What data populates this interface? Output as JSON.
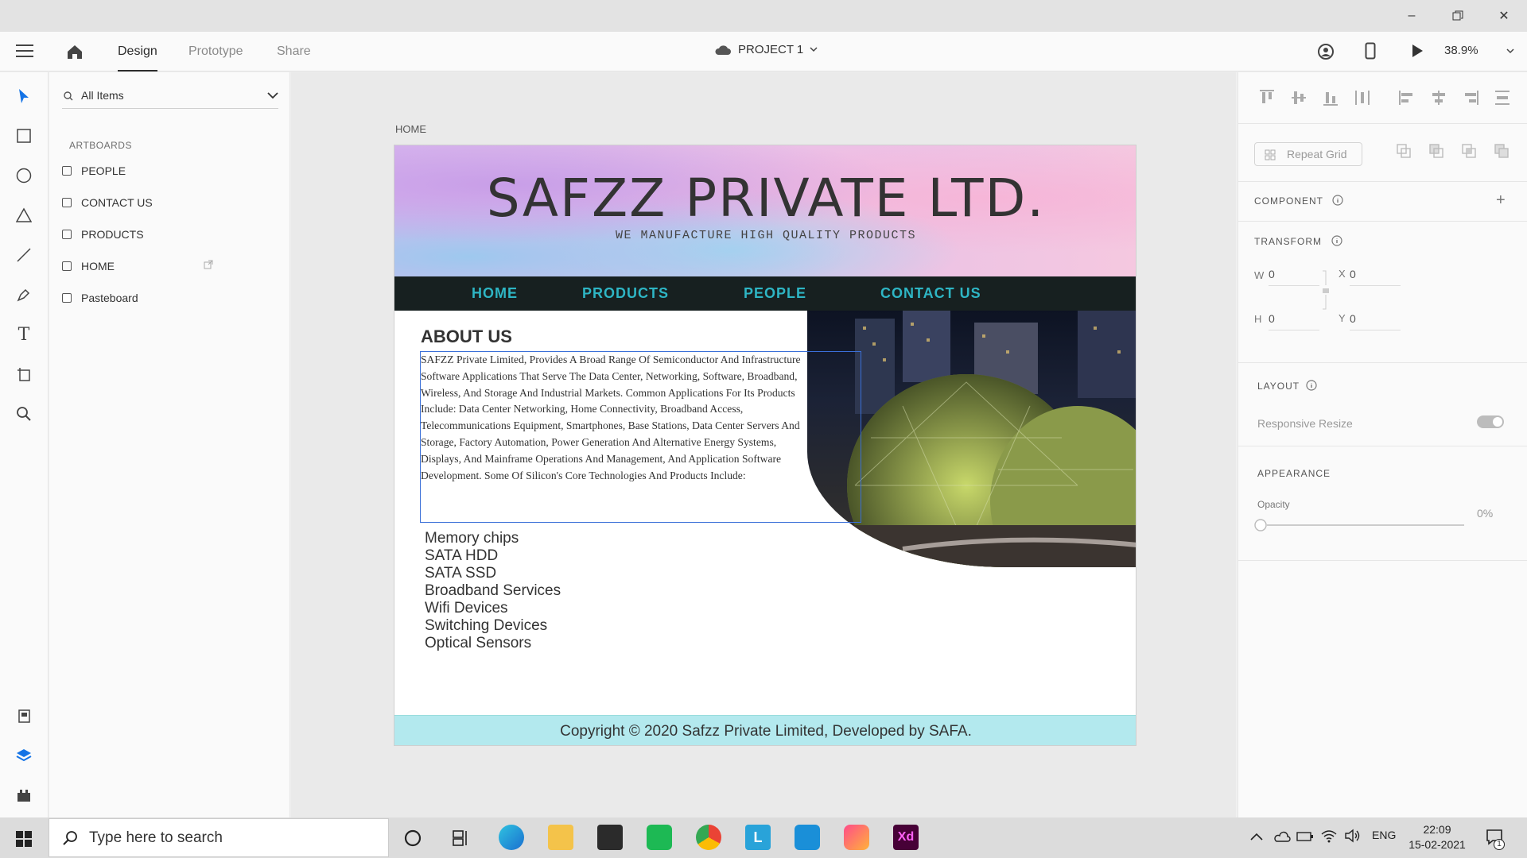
{
  "app": {
    "tabs": [
      "Design",
      "Prototype",
      "Share"
    ],
    "project_name": "PROJECT 1",
    "zoom": "38.9%"
  },
  "layers": {
    "search_placeholder": "All Items",
    "section_label": "ARTBOARDS",
    "items": [
      "PEOPLE",
      "CONTACT US",
      "PRODUCTS",
      "HOME",
      "Pasteboard"
    ]
  },
  "canvas": {
    "artboard_label": "HOME",
    "site": {
      "title": "SAFZZ PRIVATE LTD.",
      "subtitle": "WE MANUFACTURE HIGH QUALITY PRODUCTS",
      "nav": [
        "HOME",
        "PRODUCTS",
        "PEOPLE",
        "CONTACT US"
      ],
      "about_heading": "ABOUT US",
      "about_text": "SAFZZ Private Limited, Provides A Broad Range Of Semiconductor And Infrastructure Software Applications That Serve The Data Center, Networking, Software, Broadband, Wireless, And Storage And Industrial Markets. Common Applications For Its Products Include: Data Center Networking, Home Connectivity, Broadband Access, Telecommunications Equipment, Smartphones, Base Stations, Data Center Servers And Storage, Factory Automation, Power Generation And Alternative Energy Systems, Displays, And Mainframe Operations And Management, And Application Software Development. Some Of Silicon's Core Technologies And Products Include:",
      "products": [
        "Memory chips",
        "SATA HDD",
        "SATA SSD",
        "Broadband Services",
        "Wifi Devices",
        "Switching Devices",
        "Optical Sensors"
      ],
      "footer": "Copyright © 2020 Safzz Private Limited, Developed by SAFA."
    }
  },
  "props": {
    "repeat_grid": "Repeat Grid",
    "component": "COMPONENT",
    "transform": "TRANSFORM",
    "w_label": "W",
    "w_value": "0",
    "x_label": "X",
    "x_value": "0",
    "h_label": "H",
    "h_value": "0",
    "y_label": "Y",
    "y_value": "0",
    "layout": "LAYOUT",
    "responsive_resize": "Responsive Resize",
    "appearance": "APPEARANCE",
    "opacity_label": "Opacity",
    "opacity_value": "0%"
  },
  "taskbar": {
    "search_placeholder": "Type here to search",
    "lang": "ENG",
    "time": "22:09",
    "date": "15-02-2021",
    "notification_count": "1"
  }
}
